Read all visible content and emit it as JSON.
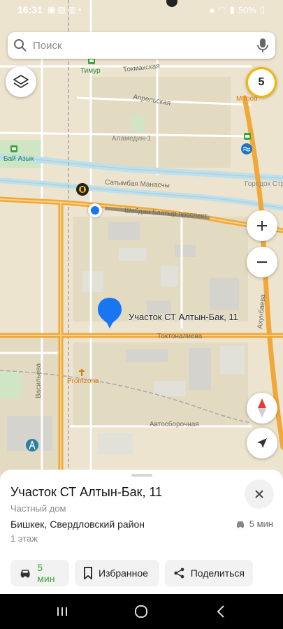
{
  "status_bar": {
    "time": "16:31",
    "battery": "50%"
  },
  "search": {
    "placeholder": "Поиск"
  },
  "map": {
    "zoom_indicator": "5",
    "labels": {
      "timur": "Тимур",
      "tokmakskaya": "Токмакская",
      "aprelskaya": "Апрельская",
      "m_food": "M food",
      "alamedin": "Аламедин-1",
      "bai_azyk": "Бай Азык",
      "satymbai": "Сатымбая Манасчы",
      "gorodok": "Городок Строит",
      "shabdan": "Шабдан Баатыр проспект",
      "pin_label": "Участок СТ Алтын-Бак, 11",
      "toktonaliev": "Токтоналиева",
      "promzona": "Promzona",
      "avtosborochnaya": "Автосборочная",
      "vasiliev": "Васильева",
      "akhunbaev": "Ахунбаева"
    }
  },
  "place": {
    "title": "Участок СТ Алтын-Бак, 11",
    "type": "Частный дом",
    "address": "Бишкек, Свердловский район",
    "floor": "1 этаж",
    "eta": "5 мин"
  },
  "actions": {
    "route": "5 мин",
    "favorites": "Избранное",
    "share": "Поделиться"
  },
  "colors": {
    "accent_green": "#3aa33a",
    "pin_blue": "#1976f2",
    "road_orange": "#f0a838",
    "canal": "#bfe0ea"
  }
}
